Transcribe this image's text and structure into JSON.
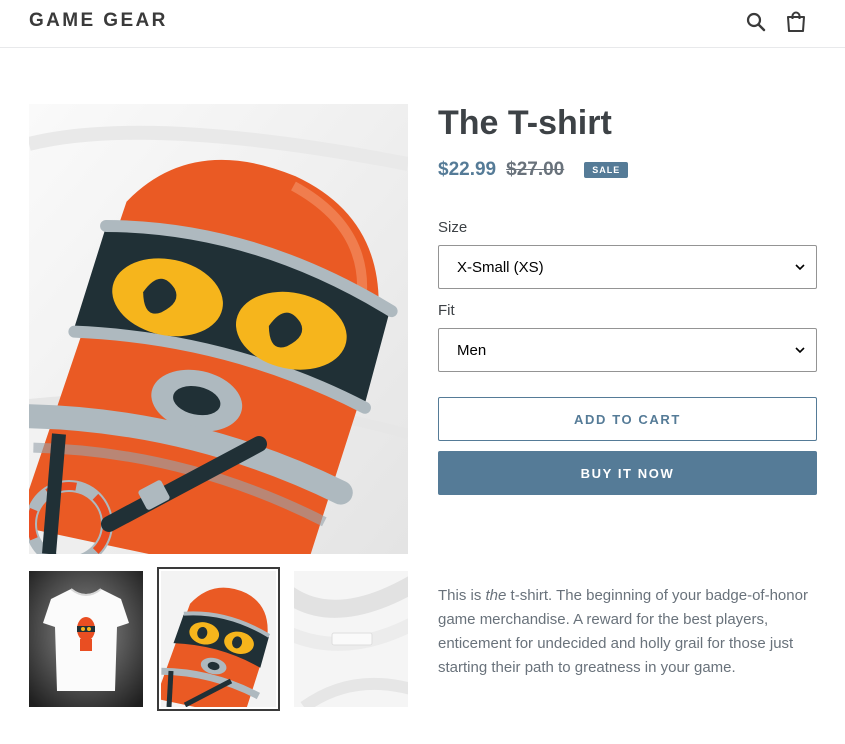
{
  "header": {
    "logo": "GAME GEAR",
    "search_icon": "search-icon",
    "cart_icon": "cart-icon"
  },
  "product": {
    "title": "The T-shirt",
    "price": "$22.99",
    "compare_price": "$27.00",
    "badge": "SALE",
    "size_label": "Size",
    "size_value": "X-Small (XS)",
    "fit_label": "Fit",
    "fit_value": "Men",
    "add_to_cart": "ADD TO CART",
    "buy_now": "BUY IT NOW",
    "desc_before": "This is ",
    "desc_em": "the",
    "desc_after": " t-shirt. The beginning of your badge-of-honor game merchandise. A reward for the best players, enticement for undecided and holly grail for those just starting their path to greatness in your game."
  },
  "colors": {
    "accent": "#557b97",
    "text": "#3d4246",
    "muted": "#69727b"
  }
}
